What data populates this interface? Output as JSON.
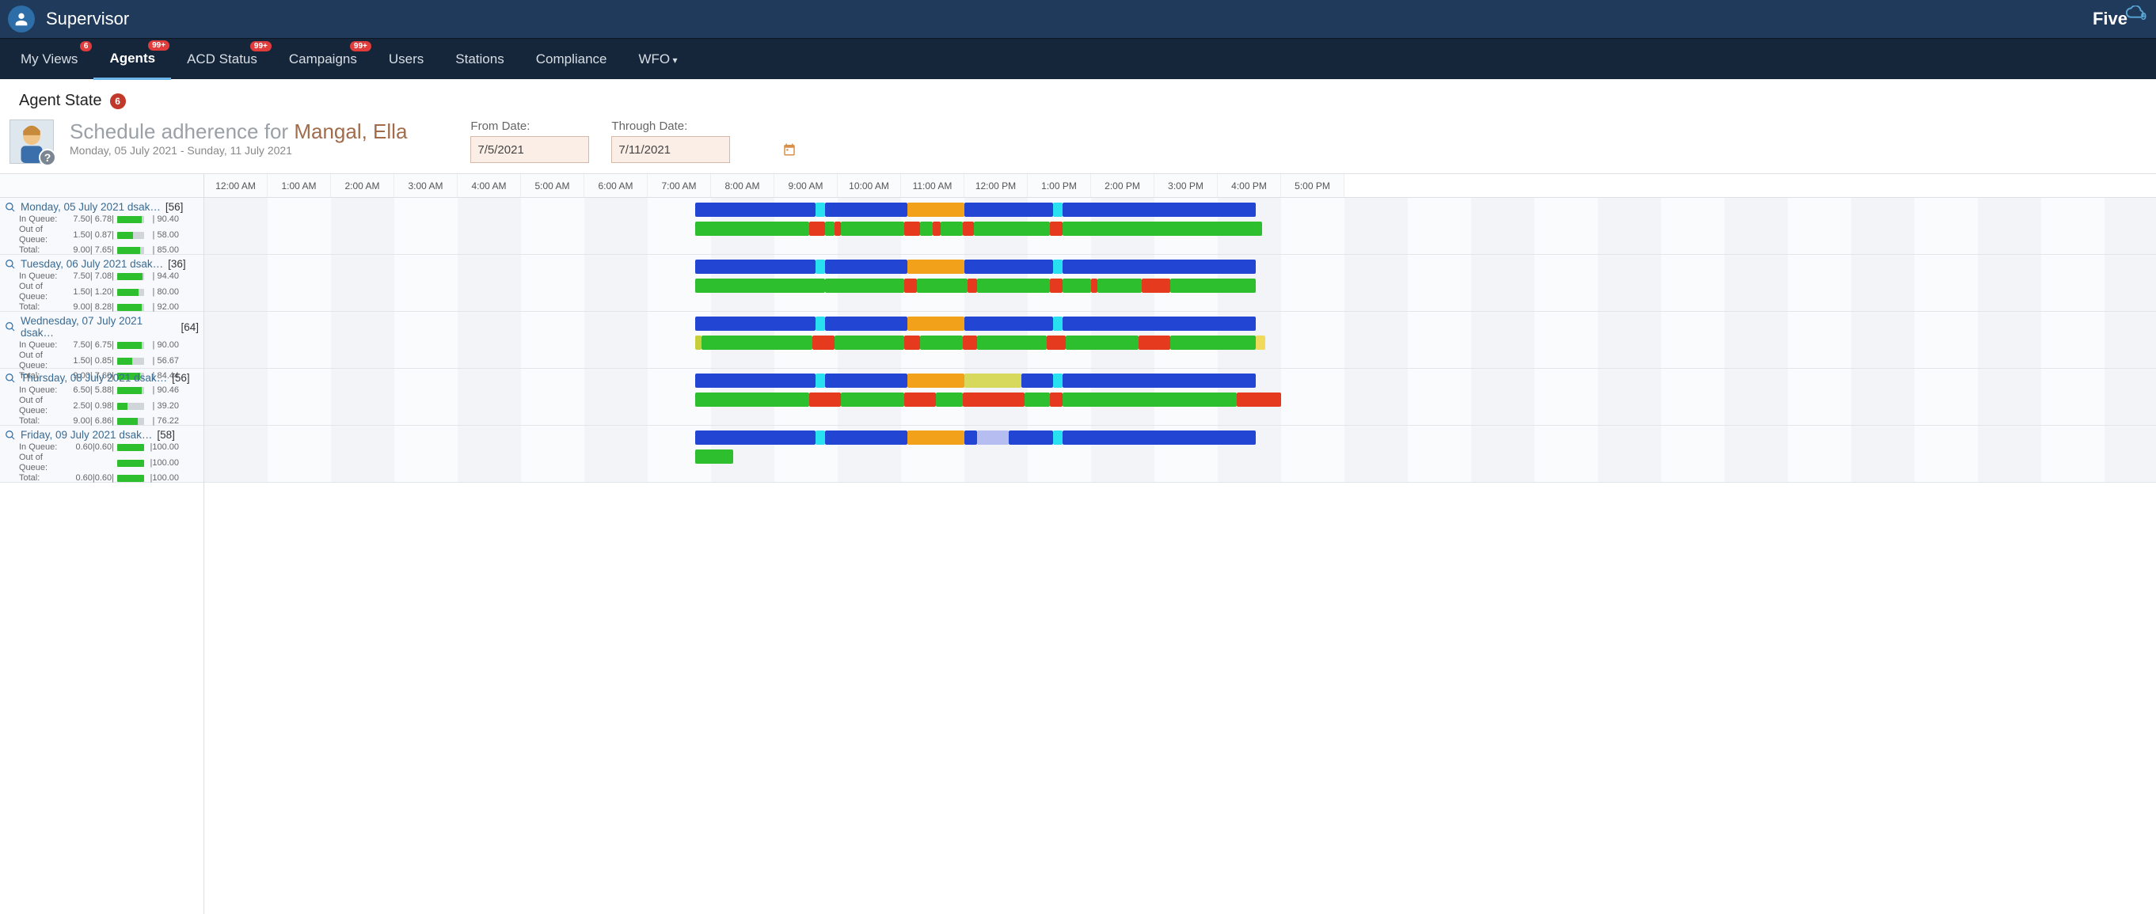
{
  "app": {
    "title": "Supervisor",
    "brand": "Five",
    "brand_suffix": "9"
  },
  "nav": {
    "tabs": [
      {
        "label": "My Views",
        "badge": "6"
      },
      {
        "label": "Agents",
        "badge": "99+",
        "active": true
      },
      {
        "label": "ACD Status",
        "badge": "99+"
      },
      {
        "label": "Campaigns",
        "badge": "99+"
      },
      {
        "label": "Users"
      },
      {
        "label": "Stations"
      },
      {
        "label": "Compliance"
      },
      {
        "label": "WFO",
        "dropdown": true
      }
    ]
  },
  "page": {
    "section": "Agent State",
    "section_count": "6",
    "report_label": "Schedule adherence for",
    "agent_name": "Mangal, Ella",
    "date_range_text": "Monday, 05 July 2021 - Sunday, 11 July 2021",
    "from_label": "From Date:",
    "from_value": "7/5/2021",
    "through_label": "Through Date:",
    "through_value": "7/11/2021"
  },
  "timeline": {
    "hours": [
      "12:00 AM",
      "1:00 AM",
      "2:00 AM",
      "3:00 AM",
      "4:00 AM",
      "5:00 AM",
      "6:00 AM",
      "7:00 AM",
      "8:00 AM",
      "9:00 AM",
      "10:00 AM",
      "11:00 AM",
      "12:00 PM",
      "1:00 PM",
      "2:00 PM",
      "3:00 PM",
      "4:00 PM",
      "5:00 PM"
    ],
    "cellWidth": 80,
    "days": [
      {
        "title": "Monday, 05 July 2021 dsak…",
        "bracket": "[56]",
        "stats": [
          {
            "lab": "In Queue:",
            "vals": "7.50| 6.78|",
            "bar": 90,
            "pct": "| 90.40"
          },
          {
            "lab": "Out of Queue:",
            "vals": "1.50| 0.87|",
            "bar": 58,
            "pct": "| 58.00"
          },
          {
            "lab": "Total:",
            "vals": "9.00| 7.65|",
            "bar": 85,
            "pct": "| 85.00"
          }
        ],
        "schedule": [
          {
            "start": 7.75,
            "end": 9.65,
            "color": "blue"
          },
          {
            "start": 9.65,
            "end": 9.8,
            "color": "cyan"
          },
          {
            "start": 9.8,
            "end": 11.1,
            "color": "blue"
          },
          {
            "start": 11.1,
            "end": 12.0,
            "color": "orange"
          },
          {
            "start": 12.0,
            "end": 13.4,
            "color": "blue"
          },
          {
            "start": 13.4,
            "end": 13.55,
            "color": "cyan"
          },
          {
            "start": 13.55,
            "end": 16.6,
            "color": "blue"
          }
        ],
        "actual": [
          {
            "start": 7.75,
            "end": 9.55,
            "color": "green"
          },
          {
            "start": 9.55,
            "end": 9.8,
            "color": "red"
          },
          {
            "start": 9.8,
            "end": 9.95,
            "color": "green"
          },
          {
            "start": 9.95,
            "end": 10.05,
            "color": "red"
          },
          {
            "start": 10.05,
            "end": 11.05,
            "color": "green"
          },
          {
            "start": 11.05,
            "end": 11.3,
            "color": "red"
          },
          {
            "start": 11.3,
            "end": 11.5,
            "color": "green"
          },
          {
            "start": 11.5,
            "end": 11.62,
            "color": "red"
          },
          {
            "start": 11.62,
            "end": 11.98,
            "color": "green"
          },
          {
            "start": 11.98,
            "end": 12.15,
            "color": "red"
          },
          {
            "start": 12.15,
            "end": 13.35,
            "color": "green"
          },
          {
            "start": 13.35,
            "end": 13.55,
            "color": "red"
          },
          {
            "start": 13.55,
            "end": 16.7,
            "color": "green"
          }
        ]
      },
      {
        "title": "Tuesday, 06 July 2021 dsak…",
        "bracket": "[36]",
        "stats": [
          {
            "lab": "In Queue:",
            "vals": "7.50| 7.08|",
            "bar": 94,
            "pct": "| 94.40"
          },
          {
            "lab": "Out of Queue:",
            "vals": "1.50| 1.20|",
            "bar": 80,
            "pct": "| 80.00"
          },
          {
            "lab": "Total:",
            "vals": "9.00| 8.28|",
            "bar": 92,
            "pct": "| 92.00"
          }
        ],
        "schedule": [
          {
            "start": 7.75,
            "end": 9.65,
            "color": "blue"
          },
          {
            "start": 9.65,
            "end": 9.8,
            "color": "cyan"
          },
          {
            "start": 9.8,
            "end": 11.1,
            "color": "blue"
          },
          {
            "start": 11.1,
            "end": 12.0,
            "color": "orange"
          },
          {
            "start": 12.0,
            "end": 13.4,
            "color": "blue"
          },
          {
            "start": 13.4,
            "end": 13.55,
            "color": "cyan"
          },
          {
            "start": 13.55,
            "end": 16.6,
            "color": "blue"
          }
        ],
        "actual": [
          {
            "start": 7.75,
            "end": 9.8,
            "color": "green"
          },
          {
            "start": 9.8,
            "end": 11.05,
            "color": "green"
          },
          {
            "start": 11.05,
            "end": 11.25,
            "color": "red"
          },
          {
            "start": 11.25,
            "end": 12.05,
            "color": "green"
          },
          {
            "start": 12.05,
            "end": 12.2,
            "color": "red"
          },
          {
            "start": 12.2,
            "end": 13.35,
            "color": "green"
          },
          {
            "start": 13.35,
            "end": 13.55,
            "color": "red"
          },
          {
            "start": 13.55,
            "end": 14.0,
            "color": "green"
          },
          {
            "start": 14.0,
            "end": 14.1,
            "color": "red"
          },
          {
            "start": 14.1,
            "end": 14.8,
            "color": "green"
          },
          {
            "start": 14.8,
            "end": 15.25,
            "color": "red"
          },
          {
            "start": 15.25,
            "end": 16.6,
            "color": "green"
          }
        ]
      },
      {
        "title": "Wednesday, 07 July 2021 dsak…",
        "bracket": "[64]",
        "stats": [
          {
            "lab": "In Queue:",
            "vals": "7.50| 6.75|",
            "bar": 90,
            "pct": "| 90.00"
          },
          {
            "lab": "Out of Queue:",
            "vals": "1.50| 0.85|",
            "bar": 57,
            "pct": "| 56.67"
          },
          {
            "lab": "Total:",
            "vals": "9.00| 7.60|",
            "bar": 84,
            "pct": "| 84.44"
          }
        ],
        "schedule": [
          {
            "start": 7.75,
            "end": 9.65,
            "color": "blue"
          },
          {
            "start": 9.65,
            "end": 9.8,
            "color": "cyan"
          },
          {
            "start": 9.8,
            "end": 11.1,
            "color": "blue"
          },
          {
            "start": 11.1,
            "end": 12.0,
            "color": "orange"
          },
          {
            "start": 12.0,
            "end": 13.4,
            "color": "blue"
          },
          {
            "start": 13.4,
            "end": 13.55,
            "color": "cyan"
          },
          {
            "start": 13.55,
            "end": 16.6,
            "color": "blue"
          }
        ],
        "actual": [
          {
            "start": 7.75,
            "end": 7.85,
            "color": "olive"
          },
          {
            "start": 7.85,
            "end": 9.6,
            "color": "green"
          },
          {
            "start": 9.6,
            "end": 9.95,
            "color": "red"
          },
          {
            "start": 9.95,
            "end": 11.05,
            "color": "green"
          },
          {
            "start": 11.05,
            "end": 11.3,
            "color": "red"
          },
          {
            "start": 11.3,
            "end": 11.98,
            "color": "green"
          },
          {
            "start": 11.98,
            "end": 12.2,
            "color": "red"
          },
          {
            "start": 12.2,
            "end": 13.3,
            "color": "green"
          },
          {
            "start": 13.3,
            "end": 13.6,
            "color": "red"
          },
          {
            "start": 13.6,
            "end": 14.75,
            "color": "green"
          },
          {
            "start": 14.75,
            "end": 15.25,
            "color": "red"
          },
          {
            "start": 15.25,
            "end": 16.6,
            "color": "green"
          },
          {
            "start": 16.6,
            "end": 16.75,
            "color": "yellow"
          }
        ]
      },
      {
        "title": "Thursday, 08 July 2021 dsak…",
        "bracket": "[56]",
        "stats": [
          {
            "lab": "In Queue:",
            "vals": "6.50| 5.88|",
            "bar": 90,
            "pct": "| 90.46"
          },
          {
            "lab": "Out of Queue:",
            "vals": "2.50| 0.98|",
            "bar": 39,
            "pct": "| 39.20"
          },
          {
            "lab": "Total:",
            "vals": "9.00| 6.86|",
            "bar": 76,
            "pct": "| 76.22"
          }
        ],
        "schedule": [
          {
            "start": 7.75,
            "end": 9.65,
            "color": "blue"
          },
          {
            "start": 9.65,
            "end": 9.8,
            "color": "cyan"
          },
          {
            "start": 9.8,
            "end": 11.1,
            "color": "blue"
          },
          {
            "start": 11.1,
            "end": 12.0,
            "color": "orange"
          },
          {
            "start": 12.0,
            "end": 12.9,
            "color": "yolive"
          },
          {
            "start": 12.9,
            "end": 13.4,
            "color": "blue"
          },
          {
            "start": 13.4,
            "end": 13.55,
            "color": "cyan"
          },
          {
            "start": 13.55,
            "end": 16.6,
            "color": "blue"
          }
        ],
        "actual": [
          {
            "start": 7.75,
            "end": 9.55,
            "color": "green"
          },
          {
            "start": 9.55,
            "end": 10.05,
            "color": "red"
          },
          {
            "start": 10.05,
            "end": 11.05,
            "color": "green"
          },
          {
            "start": 11.05,
            "end": 11.55,
            "color": "red"
          },
          {
            "start": 11.55,
            "end": 11.98,
            "color": "green"
          },
          {
            "start": 11.98,
            "end": 12.95,
            "color": "red"
          },
          {
            "start": 12.95,
            "end": 13.35,
            "color": "green"
          },
          {
            "start": 13.35,
            "end": 13.55,
            "color": "red"
          },
          {
            "start": 13.55,
            "end": 16.3,
            "color": "green"
          },
          {
            "start": 16.3,
            "end": 17.0,
            "color": "red"
          }
        ]
      },
      {
        "title": "Friday, 09 July 2021  dsak…",
        "bracket": "[58]",
        "stats": [
          {
            "lab": "In Queue:",
            "vals": "0.60|0.60|",
            "bar": 100,
            "pct": "|100.00"
          },
          {
            "lab": "Out of Queue:",
            "vals": "",
            "bar": 100,
            "pct": "|100.00"
          },
          {
            "lab": "Total:",
            "vals": "0.60|0.60|",
            "bar": 100,
            "pct": "|100.00"
          }
        ],
        "schedule": [
          {
            "start": 7.75,
            "end": 9.65,
            "color": "blue"
          },
          {
            "start": 9.65,
            "end": 9.8,
            "color": "cyan"
          },
          {
            "start": 9.8,
            "end": 11.1,
            "color": "blue"
          },
          {
            "start": 11.1,
            "end": 12.0,
            "color": "orange"
          },
          {
            "start": 12.0,
            "end": 12.2,
            "color": "blue"
          },
          {
            "start": 12.2,
            "end": 12.7,
            "color": "lav"
          },
          {
            "start": 12.7,
            "end": 13.4,
            "color": "blue"
          },
          {
            "start": 13.4,
            "end": 13.55,
            "color": "cyan"
          },
          {
            "start": 13.55,
            "end": 16.6,
            "color": "blue"
          }
        ],
        "actual": [
          {
            "start": 7.75,
            "end": 8.35,
            "color": "green"
          }
        ]
      }
    ]
  }
}
